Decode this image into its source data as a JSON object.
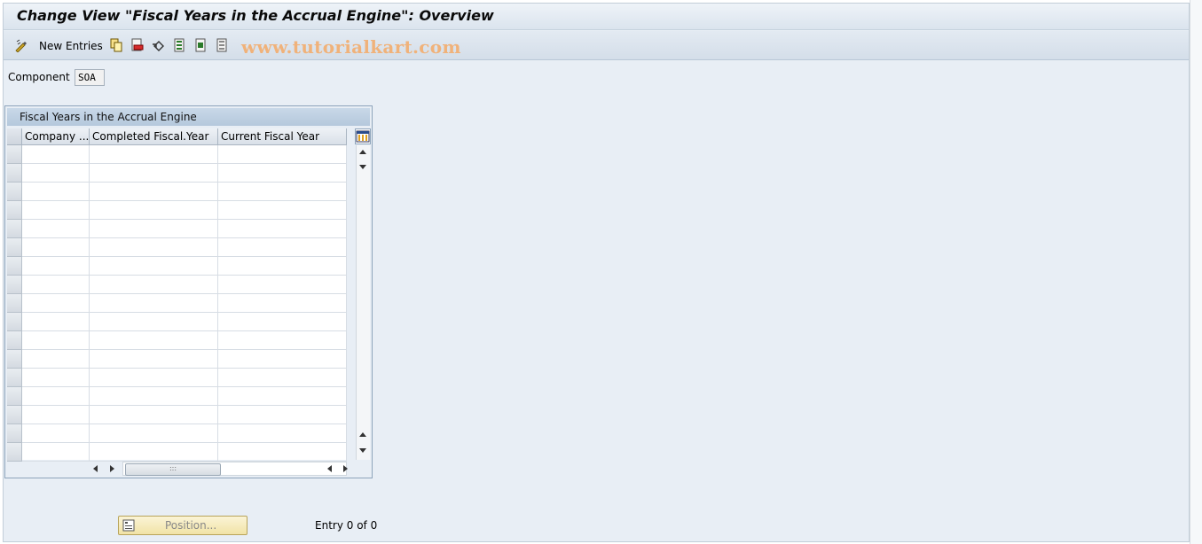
{
  "window": {
    "title": "Change View \"Fiscal Years in the Accrual Engine\": Overview"
  },
  "toolbar": {
    "new_entries_label": "New Entries",
    "icons": [
      "display-change-icon",
      "copy-icon",
      "delete-icon",
      "undo-icon",
      "select-all-icon",
      "select-block-icon",
      "deselect-all-icon"
    ]
  },
  "watermark": "www.tutorialkart.com",
  "component": {
    "label": "Component",
    "value": "SOA"
  },
  "table": {
    "caption": "Fiscal Years in the Accrual Engine",
    "columns": [
      "Company ...",
      "Completed Fiscal.Year",
      "Current Fiscal Year"
    ],
    "rows": [],
    "empty_row_count": 17
  },
  "footer": {
    "position_button": "Position...",
    "entry_info": "Entry 0 of 0"
  },
  "colors": {
    "background": "#e8eef5",
    "table_caption": "#b5c8dc",
    "watermark": "#f0b27a",
    "position_button": "#f1e3a6"
  }
}
